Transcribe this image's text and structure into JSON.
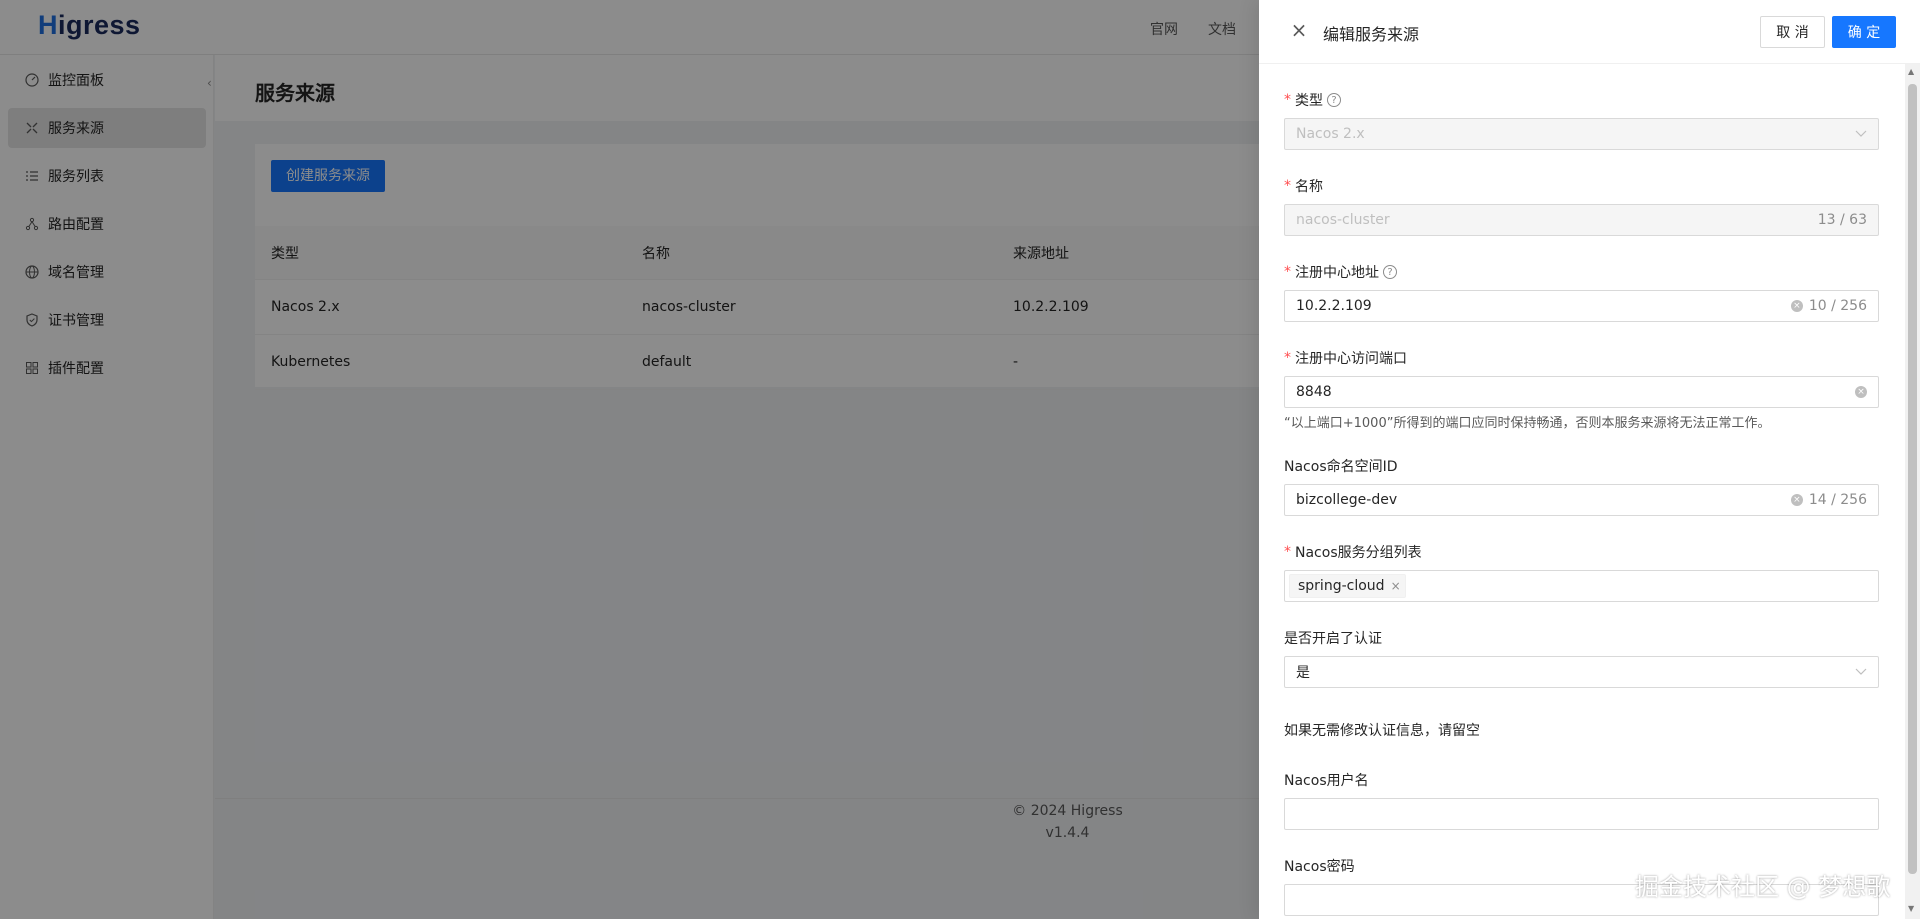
{
  "app": {
    "logo": "Higress",
    "logo_first": "H",
    "logo_rest": "igress"
  },
  "header": {
    "links": [
      "官网",
      "文档"
    ]
  },
  "sidebar": {
    "items": [
      {
        "label": "监控面板",
        "icon": "dashboard-icon"
      },
      {
        "label": "服务来源",
        "icon": "service-source-icon",
        "active": true
      },
      {
        "label": "服务列表",
        "icon": "list-icon"
      },
      {
        "label": "路由配置",
        "icon": "route-icon"
      },
      {
        "label": "域名管理",
        "icon": "globe-icon"
      },
      {
        "label": "证书管理",
        "icon": "shield-icon"
      },
      {
        "label": "插件配置",
        "icon": "plugin-icon"
      }
    ]
  },
  "page": {
    "title": "服务来源",
    "create_button": "创建服务来源",
    "table": {
      "columns": [
        "类型",
        "名称",
        "来源地址"
      ],
      "rows": [
        [
          "Nacos 2.x",
          "nacos-cluster",
          "10.2.2.109"
        ],
        [
          "Kubernetes",
          "default",
          "-"
        ]
      ]
    }
  },
  "footer": {
    "copyright": "© 2024 Higress",
    "version": "v1.4.4"
  },
  "drawer": {
    "title": "编辑服务来源",
    "cancel": "取 消",
    "ok": "确 定",
    "fields": {
      "type": {
        "label": "类型",
        "value": "Nacos 2.x",
        "required": true
      },
      "name": {
        "label": "名称",
        "value": "nacos-cluster",
        "count": "13 / 63",
        "required": true
      },
      "registry_address": {
        "label": "注册中心地址",
        "value": "10.2.2.109",
        "count": "10 / 256",
        "required": true
      },
      "registry_port": {
        "label": "注册中心访问端口",
        "value": "8848",
        "required": true,
        "hint": "“以上端口+1000”所得到的端口应同时保持畅通，否则本服务来源将无法正常工作。"
      },
      "namespace_id": {
        "label": "Nacos命名空间ID",
        "value": "bizcollege-dev",
        "count": "14 / 256"
      },
      "groups": {
        "label": "Nacos服务分组列表",
        "tags": [
          "spring-cloud"
        ],
        "required": true
      },
      "auth_enabled": {
        "label": "是否开启了认证",
        "value": "是"
      },
      "auth_hint": "如果无需修改认证信息，请留空",
      "username": {
        "label": "Nacos用户名",
        "value": ""
      },
      "password": {
        "label": "Nacos密码",
        "value": ""
      }
    }
  },
  "watermark": "掘金技术社区 @ 梦想歌",
  "colors": {
    "primary": "#1677ff",
    "required": "#ff4d4f",
    "mask": "rgba(0,0,0,0.45)"
  }
}
